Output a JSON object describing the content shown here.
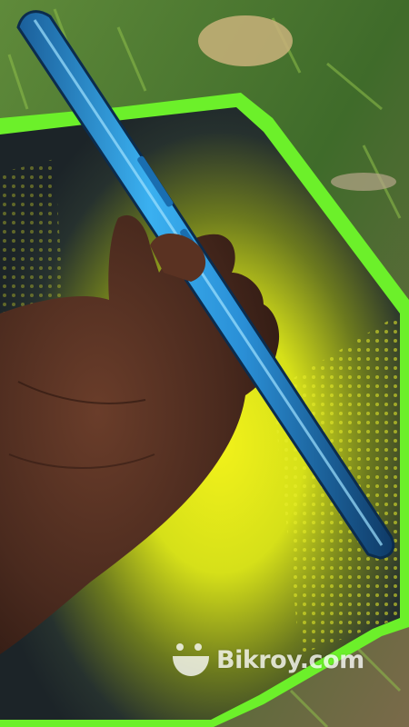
{
  "photo": {
    "subject": "hand-holding-blue-smartphone-side-view",
    "colors": {
      "grass": "#4f7d33",
      "mat_border": "#6cf02a",
      "mat_yellow": "#e6e619",
      "mat_dark": "#1f2a2e",
      "phone_blue": "#2f9be0",
      "skin": "#4a2a1e"
    }
  },
  "watermark": {
    "logo_icon": "bikroy-smile-logo-icon",
    "text": "Bikroy.com"
  }
}
